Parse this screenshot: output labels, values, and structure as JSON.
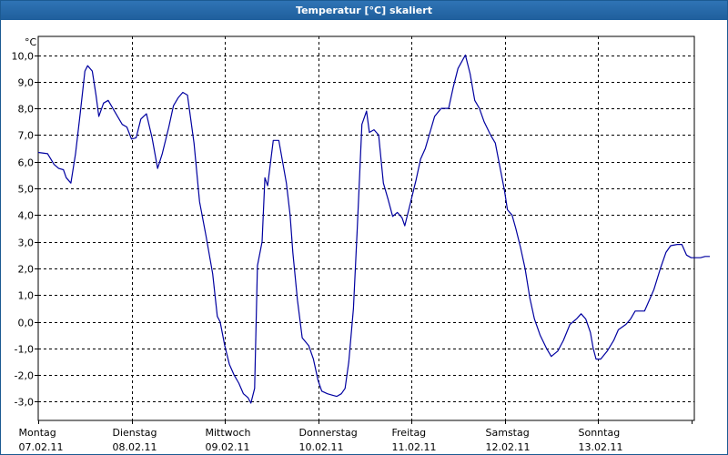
{
  "window": {
    "title": "Temperatur [°C] skaliert"
  },
  "colors": {
    "titlebar": "#1f5f9c",
    "line": "#0000a0",
    "grid": "#000000"
  },
  "chart_data": {
    "type": "line",
    "title": "Temperatur [°C] skaliert",
    "ylabel": "°C",
    "xlabel": "",
    "ylim": [
      -3.7,
      10.7
    ],
    "xlim": [
      0,
      7
    ],
    "grid": true,
    "y_ticks": [
      10.0,
      9.0,
      8.0,
      7.0,
      6.0,
      5.0,
      4.0,
      3.0,
      2.0,
      1.0,
      0.0,
      -1.0,
      -2.0,
      -3.0
    ],
    "y_tick_labels": [
      "10,0",
      "9,0",
      "8,0",
      "7,0",
      "6,0",
      "5,0",
      "4,0",
      "3,0",
      "2,0",
      "1,0",
      "0,0",
      "-1,0",
      "-2,0",
      "-3,0"
    ],
    "x_tick_labels": [
      {
        "day": "Montag",
        "date": "07.02.11"
      },
      {
        "day": "Dienstag",
        "date": "08.02.11"
      },
      {
        "day": "Mittwoch",
        "date": "09.02.11"
      },
      {
        "day": "Donnerstag",
        "date": "10.02.11"
      },
      {
        "day": "Freitag",
        "date": "11.02.11"
      },
      {
        "day": "Samstag",
        "date": "12.02.11"
      },
      {
        "day": "Sonntag",
        "date": "13.02.11"
      }
    ],
    "series": [
      {
        "points": [
          [
            0.0,
            6.35
          ],
          [
            0.1,
            6.3
          ],
          [
            0.17,
            5.9
          ],
          [
            0.22,
            5.75
          ],
          [
            0.27,
            5.7
          ],
          [
            0.3,
            5.4
          ],
          [
            0.35,
            5.2
          ],
          [
            0.4,
            6.3
          ],
          [
            0.45,
            7.8
          ],
          [
            0.5,
            9.4
          ],
          [
            0.53,
            9.6
          ],
          [
            0.58,
            9.4
          ],
          [
            0.62,
            8.5
          ],
          [
            0.65,
            7.7
          ],
          [
            0.7,
            8.2
          ],
          [
            0.75,
            8.3
          ],
          [
            0.8,
            8.0
          ],
          [
            0.9,
            7.4
          ],
          [
            0.95,
            7.3
          ],
          [
            1.0,
            6.85
          ],
          [
            1.05,
            6.9
          ],
          [
            1.1,
            7.6
          ],
          [
            1.16,
            7.8
          ],
          [
            1.22,
            6.9
          ],
          [
            1.28,
            5.75
          ],
          [
            1.33,
            6.3
          ],
          [
            1.4,
            7.3
          ],
          [
            1.45,
            8.1
          ],
          [
            1.5,
            8.4
          ],
          [
            1.55,
            8.6
          ],
          [
            1.6,
            8.5
          ],
          [
            1.67,
            6.7
          ],
          [
            1.73,
            4.5
          ],
          [
            1.8,
            3.2
          ],
          [
            1.87,
            1.8
          ],
          [
            1.92,
            0.2
          ],
          [
            1.95,
            0.0
          ],
          [
            2.0,
            -0.9
          ],
          [
            2.05,
            -1.6
          ],
          [
            2.1,
            -2.0
          ],
          [
            2.15,
            -2.3
          ],
          [
            2.2,
            -2.7
          ],
          [
            2.25,
            -2.85
          ],
          [
            2.28,
            -3.05
          ],
          [
            2.32,
            -2.5
          ],
          [
            2.35,
            2.1
          ],
          [
            2.4,
            3.0
          ],
          [
            2.43,
            5.4
          ],
          [
            2.46,
            5.1
          ],
          [
            2.52,
            6.8
          ],
          [
            2.58,
            6.8
          ],
          [
            2.66,
            5.2
          ],
          [
            2.7,
            4.0
          ],
          [
            2.73,
            2.6
          ],
          [
            2.78,
            0.8
          ],
          [
            2.83,
            -0.6
          ],
          [
            2.9,
            -0.9
          ],
          [
            2.95,
            -1.4
          ],
          [
            3.0,
            -2.2
          ],
          [
            3.04,
            -2.6
          ],
          [
            3.1,
            -2.7
          ],
          [
            3.15,
            -2.75
          ],
          [
            3.2,
            -2.8
          ],
          [
            3.25,
            -2.7
          ],
          [
            3.29,
            -2.5
          ],
          [
            3.33,
            -1.5
          ],
          [
            3.38,
            0.5
          ],
          [
            3.42,
            3.5
          ],
          [
            3.47,
            7.4
          ],
          [
            3.52,
            7.9
          ],
          [
            3.55,
            7.1
          ],
          [
            3.6,
            7.2
          ],
          [
            3.65,
            7.0
          ],
          [
            3.7,
            5.2
          ],
          [
            3.75,
            4.6
          ],
          [
            3.8,
            3.95
          ],
          [
            3.85,
            4.1
          ],
          [
            3.9,
            3.9
          ],
          [
            3.93,
            3.6
          ],
          [
            3.98,
            4.3
          ],
          [
            4.05,
            5.3
          ],
          [
            4.1,
            6.1
          ],
          [
            4.15,
            6.5
          ],
          [
            4.2,
            7.1
          ],
          [
            4.25,
            7.7
          ],
          [
            4.32,
            8.0
          ],
          [
            4.4,
            8.0
          ],
          [
            4.45,
            8.8
          ],
          [
            4.5,
            9.5
          ],
          [
            4.58,
            10.0
          ],
          [
            4.63,
            9.3
          ],
          [
            4.68,
            8.3
          ],
          [
            4.73,
            8.0
          ],
          [
            4.78,
            7.5
          ],
          [
            4.85,
            7.0
          ],
          [
            4.9,
            6.7
          ],
          [
            4.95,
            5.8
          ],
          [
            5.0,
            4.9
          ],
          [
            5.03,
            4.2
          ],
          [
            5.08,
            4.0
          ],
          [
            5.12,
            3.5
          ],
          [
            5.17,
            2.8
          ],
          [
            5.22,
            2.0
          ],
          [
            5.27,
            0.9
          ],
          [
            5.32,
            0.1
          ],
          [
            5.38,
            -0.5
          ],
          [
            5.45,
            -1.0
          ],
          [
            5.5,
            -1.3
          ],
          [
            5.57,
            -1.1
          ],
          [
            5.63,
            -0.7
          ],
          [
            5.7,
            -0.1
          ],
          [
            5.77,
            0.1
          ],
          [
            5.82,
            0.3
          ],
          [
            5.87,
            0.1
          ],
          [
            5.92,
            -0.4
          ],
          [
            5.95,
            -1.0
          ],
          [
            5.98,
            -1.4
          ],
          [
            6.03,
            -1.4
          ],
          [
            6.1,
            -1.1
          ],
          [
            6.17,
            -0.7
          ],
          [
            6.22,
            -0.3
          ],
          [
            6.3,
            -0.1
          ],
          [
            6.35,
            0.1
          ],
          [
            6.4,
            0.4
          ],
          [
            6.45,
            0.4
          ],
          [
            6.5,
            0.4
          ],
          [
            6.55,
            0.8
          ],
          [
            6.6,
            1.2
          ],
          [
            6.67,
            2.0
          ],
          [
            6.73,
            2.6
          ],
          [
            6.78,
            2.85
          ],
          [
            6.85,
            2.9
          ],
          [
            6.9,
            2.9
          ],
          [
            6.95,
            2.5
          ],
          [
            7.0,
            2.4
          ],
          [
            7.05,
            2.4
          ],
          [
            7.1,
            2.4
          ],
          [
            7.15,
            2.45
          ],
          [
            7.2,
            2.45
          ]
        ]
      }
    ]
  }
}
